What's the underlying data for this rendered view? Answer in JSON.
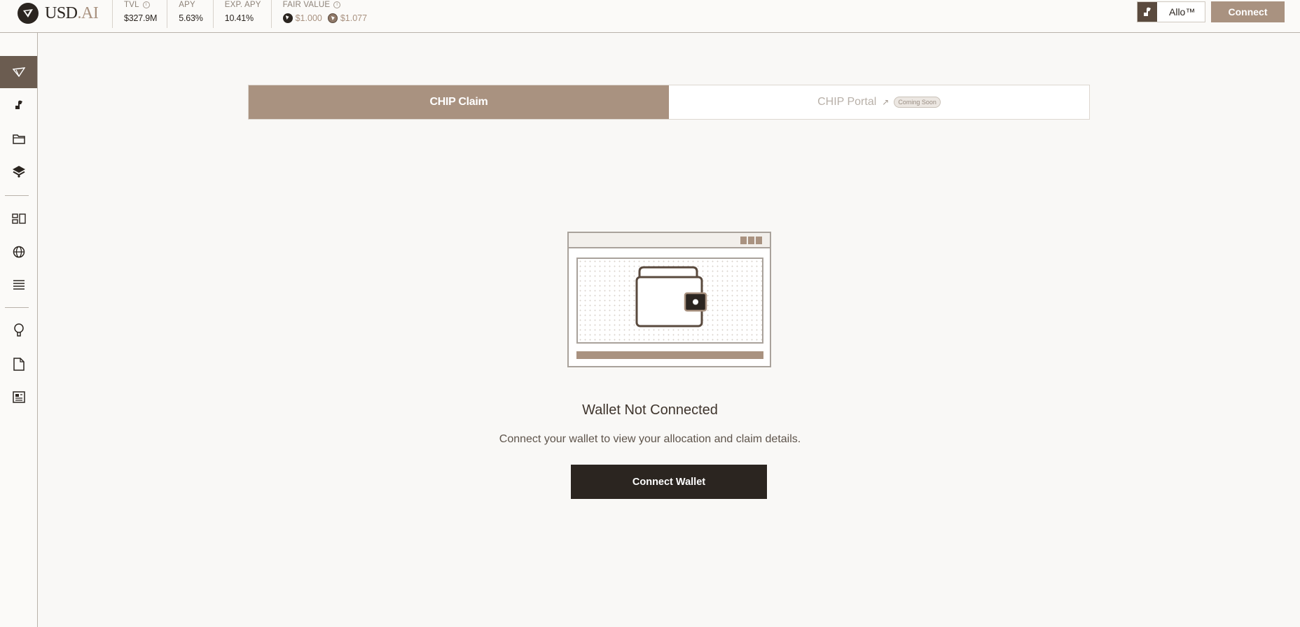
{
  "brand": {
    "name_main": "USD",
    "name_accent": ".AI"
  },
  "stats": {
    "tvl": {
      "label": "TVL",
      "value": "$327.9M"
    },
    "apy": {
      "label": "APY",
      "value": "5.63%"
    },
    "exp_apy": {
      "label": "EXP. APY",
      "value": "10.41%"
    },
    "fair_value": {
      "label": "FAIR VALUE",
      "value_a": "$1.000",
      "value_b": "$1.077"
    }
  },
  "header": {
    "allo_label": "Allo™",
    "connect_label": "Connect"
  },
  "sidebar": {
    "items": [
      {
        "name": "sidebar-item-chip",
        "icon": "diamond-icon",
        "active": true
      },
      {
        "name": "sidebar-item-allo",
        "icon": "allo-icon"
      },
      {
        "name": "sidebar-item-folder",
        "icon": "folder-icon"
      },
      {
        "name": "sidebar-item-layers",
        "icon": "layers-icon"
      },
      {
        "name": "sidebar-item-dashboard",
        "icon": "dashboard-icon"
      },
      {
        "name": "sidebar-item-globe",
        "icon": "globe-icon"
      },
      {
        "name": "sidebar-item-stack",
        "icon": "stack-icon"
      },
      {
        "name": "sidebar-item-ideas",
        "icon": "lightbulb-icon"
      },
      {
        "name": "sidebar-item-docs",
        "icon": "document-icon"
      },
      {
        "name": "sidebar-item-news",
        "icon": "newspaper-icon"
      }
    ]
  },
  "tabs": {
    "claim": "CHIP Claim",
    "portal": "CHIP Portal",
    "portal_arrow": "↗",
    "portal_badge": "Coming Soon"
  },
  "main": {
    "title": "Wallet Not Connected",
    "subtitle": "Connect your wallet to view your allocation and claim details.",
    "button": "Connect Wallet"
  },
  "colors": {
    "accent": "#a99280",
    "dark": "#2b2520",
    "sidebar_active": "#6b5c50"
  }
}
